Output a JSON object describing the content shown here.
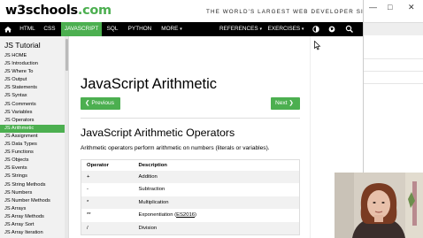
{
  "header": {
    "logo_main": "w3schools",
    "logo_suffix": ".com",
    "tagline": "THE WORLD'S LARGEST WEB DEVELOPER SITE"
  },
  "nav": {
    "items": [
      {
        "label": "HTML"
      },
      {
        "label": "CSS"
      },
      {
        "label": "JAVASCRIPT"
      },
      {
        "label": "SQL"
      },
      {
        "label": "PYTHON"
      },
      {
        "label": "MORE"
      },
      {
        "label": "REFERENCES"
      },
      {
        "label": "EXERCISES"
      }
    ],
    "active_index": 2,
    "more_caret": "▾",
    "references_caret": "▾",
    "exercises_caret": "▾"
  },
  "sidebar": {
    "title": "JS Tutorial",
    "items": [
      "JS HOME",
      "JS Introduction",
      "JS Where To",
      "JS Output",
      "JS Statements",
      "JS Syntax",
      "JS Comments",
      "JS Variables",
      "JS Operators",
      "JS Arithmetic",
      "JS Assignment",
      "JS Data Types",
      "JS Functions",
      "JS Objects",
      "JS Events",
      "JS Strings",
      "JS String Methods",
      "JS Numbers",
      "JS Number Methods",
      "JS Arrays",
      "JS Array Methods",
      "JS Array Sort",
      "JS Array Iteration"
    ],
    "active_index": 9
  },
  "main": {
    "title": "JavaScript Arithmetic",
    "prev_label": "❮ Previous",
    "next_label": "Next ❯",
    "section_title": "JavaScript Arithmetic Operators",
    "intro": "Arithmetic operators perform arithmetic on numbers (literals or variables).",
    "table": {
      "headers": [
        "Operator",
        "Description"
      ],
      "rows": [
        [
          "+",
          "Addition"
        ],
        [
          "-",
          "Subtraction"
        ],
        [
          "*",
          "Multiplication"
        ],
        [
          "**",
          "Exponentiation (",
          "ES2016",
          ")"
        ],
        [
          "/",
          "Division"
        ]
      ]
    }
  },
  "colors": {
    "accent": "#4CAF50",
    "nav_bg": "#000000",
    "sidebar_bg": "#f1f1f1"
  }
}
